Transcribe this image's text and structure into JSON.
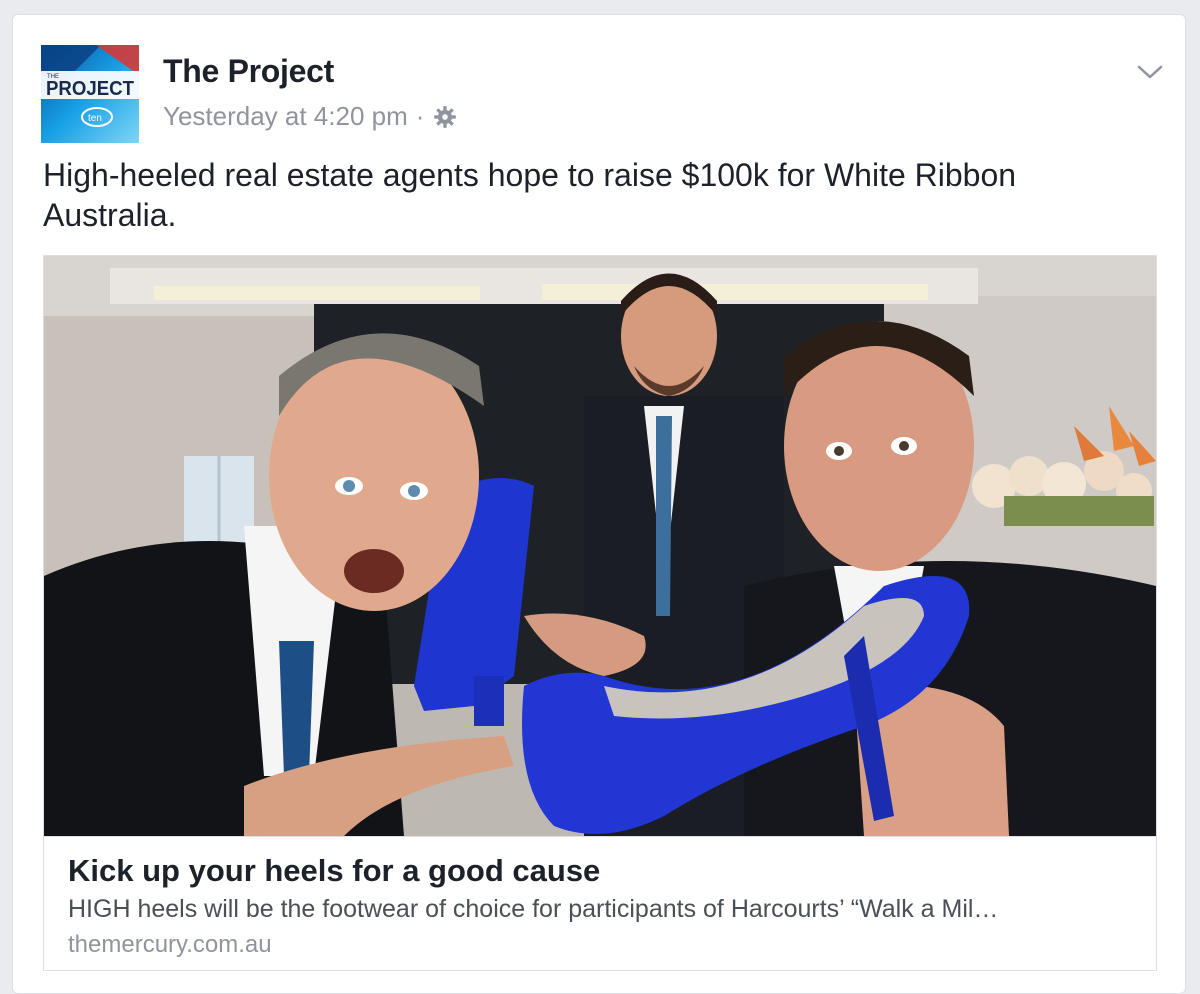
{
  "post": {
    "author": "The Project",
    "timestamp": "Yesterday at 4:20 pm",
    "separator": "·",
    "privacy_icon": "gear-icon",
    "menu_icon": "chevron-down-icon",
    "text": "High-heeled real estate agents hope to raise $100k for White Ribbon Australia."
  },
  "avatar": {
    "logo_top": "THE",
    "logo_main": "PROJECT",
    "logo_sub": "ten"
  },
  "link_preview": {
    "title": "Kick up your heels for a good cause",
    "description": "HIGH heels will be the footwear of choice for participants of Harcourts’ “Walk a Mil…",
    "domain": "themercury.com.au"
  },
  "colors": {
    "author": "#1d2129",
    "meta": "#90949c",
    "shoe_blue": "#1f2fc4",
    "logo_bg": "#12a7e0"
  }
}
